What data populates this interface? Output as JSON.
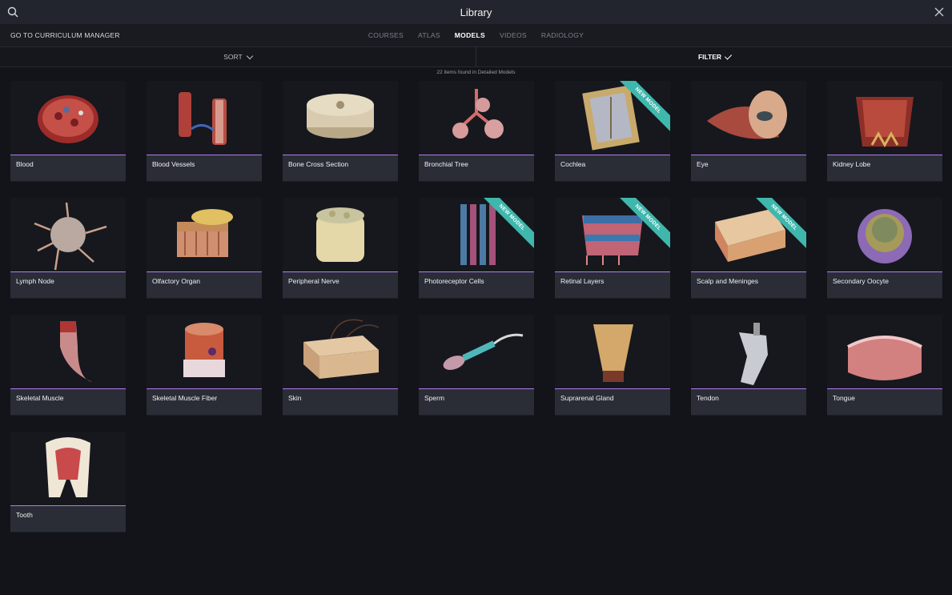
{
  "header": {
    "title": "Library",
    "search_icon": "search-icon",
    "close_icon": "close-icon"
  },
  "nav": {
    "curriculum_link": "GO TO CURRICULUM MANAGER",
    "tabs": [
      {
        "label": "COURSES",
        "active": false
      },
      {
        "label": "ATLAS",
        "active": false
      },
      {
        "label": "MODELS",
        "active": true
      },
      {
        "label": "VIDEOS",
        "active": false
      },
      {
        "label": "RADIOLOGY",
        "active": false
      }
    ]
  },
  "toolbar": {
    "sort_label": "SORT",
    "filter_label": "FILTER"
  },
  "results": {
    "count_text": "22 items found in Detailed Models"
  },
  "colors": {
    "accent": "#b17cf1",
    "ribbon": "#3fb7ac"
  },
  "models": [
    {
      "name": "Blood",
      "new": false,
      "thumb": "blood"
    },
    {
      "name": "Blood Vessels",
      "new": false,
      "thumb": "vessels"
    },
    {
      "name": "Bone Cross Section",
      "new": false,
      "thumb": "bone"
    },
    {
      "name": "Bronchial Tree",
      "new": false,
      "thumb": "bronchial"
    },
    {
      "name": "Cochlea",
      "new": true,
      "thumb": "cochlea"
    },
    {
      "name": "Eye",
      "new": false,
      "thumb": "eye"
    },
    {
      "name": "Kidney Lobe",
      "new": false,
      "thumb": "kidney"
    },
    {
      "name": "Lymph Node",
      "new": false,
      "thumb": "lymph"
    },
    {
      "name": "Olfactory Organ",
      "new": false,
      "thumb": "olfactory"
    },
    {
      "name": "Peripheral Nerve",
      "new": false,
      "thumb": "nerve"
    },
    {
      "name": "Photoreceptor Cells",
      "new": true,
      "thumb": "photoreceptor"
    },
    {
      "name": "Retinal Layers",
      "new": true,
      "thumb": "retina"
    },
    {
      "name": "Scalp and Meninges",
      "new": true,
      "thumb": "scalp"
    },
    {
      "name": "Secondary Oocyte",
      "new": false,
      "thumb": "oocyte"
    },
    {
      "name": "Skeletal Muscle",
      "new": false,
      "thumb": "muscle"
    },
    {
      "name": "Skeletal Muscle Fiber",
      "new": false,
      "thumb": "fiber"
    },
    {
      "name": "Skin",
      "new": false,
      "thumb": "skin"
    },
    {
      "name": "Sperm",
      "new": false,
      "thumb": "sperm"
    },
    {
      "name": "Suprarenal Gland",
      "new": false,
      "thumb": "suprarenal"
    },
    {
      "name": "Tendon",
      "new": false,
      "thumb": "tendon"
    },
    {
      "name": "Tongue",
      "new": false,
      "thumb": "tongue"
    },
    {
      "name": "Tooth",
      "new": false,
      "thumb": "tooth"
    }
  ],
  "badge_text": "NEW MODEL"
}
